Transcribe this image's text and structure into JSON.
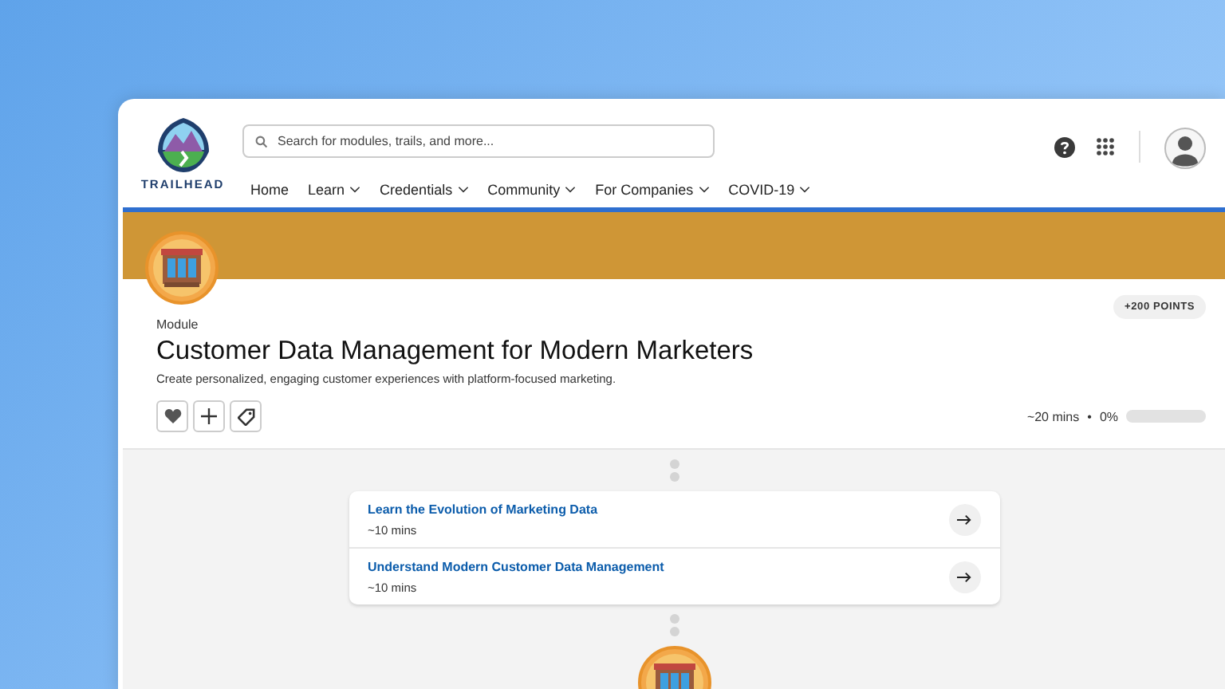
{
  "header": {
    "logo_text": "TRAILHEAD",
    "search": {
      "placeholder": "Search for modules, trails, and more..."
    },
    "nav": [
      {
        "label": "Home",
        "has_dropdown": false
      },
      {
        "label": "Learn",
        "has_dropdown": true
      },
      {
        "label": "Credentials",
        "has_dropdown": true
      },
      {
        "label": "Community",
        "has_dropdown": true
      },
      {
        "label": "For Companies",
        "has_dropdown": true
      },
      {
        "label": "COVID-19",
        "has_dropdown": true
      }
    ]
  },
  "module": {
    "points": "+200 POINTS",
    "type_label": "Module",
    "title": "Customer Data Management for Modern Marketers",
    "description": "Create personalized, engaging customer experiences with platform-focused marketing.",
    "duration": "~20 mins",
    "separator": "•",
    "percent": "0%",
    "progress": {
      "level": 0
    }
  },
  "units": [
    {
      "title": "Learn the Evolution of Marketing Data",
      "duration": "~10 mins"
    },
    {
      "title": "Understand Modern Customer Data Management",
      "duration": "~10 mins"
    }
  ]
}
